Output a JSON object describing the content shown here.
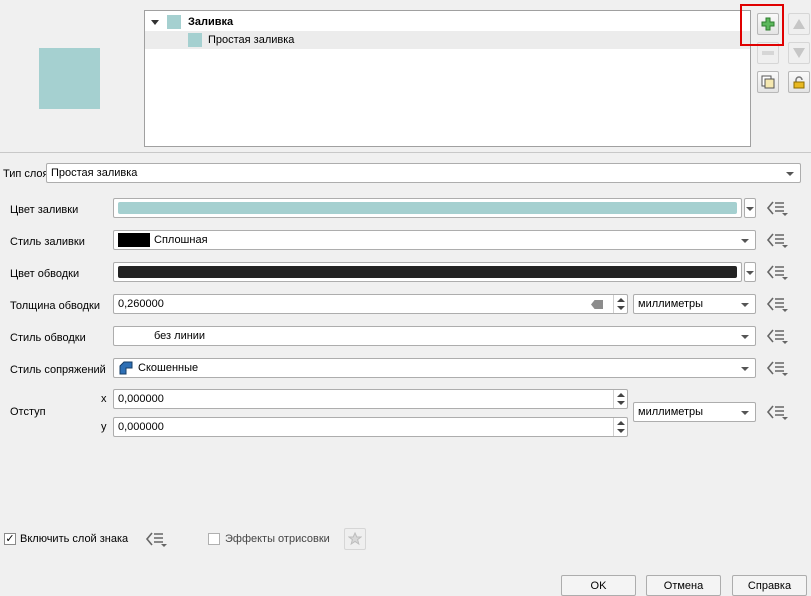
{
  "preview": {
    "color": "#a5d0d0"
  },
  "tree": {
    "items": [
      {
        "label": "Заливка",
        "color": "#a5d0d0"
      },
      {
        "label": "Простая заливка",
        "color": "#a5d0d0"
      }
    ]
  },
  "side_buttons": {
    "add": "plus-icon",
    "remove": "minus-icon",
    "move_up": "arrow-up-icon",
    "move_down": "arrow-down-icon",
    "duplicate": "duplicate-icon",
    "lock": "lock-icon"
  },
  "layer_type": {
    "label": "Тип слоя",
    "value": "Простая заливка"
  },
  "fields": {
    "fill_color": {
      "label": "Цвет заливки",
      "color": "#a5d0d0"
    },
    "fill_style": {
      "label": "Стиль заливки",
      "value": "Сплошная",
      "swatch": "#000000"
    },
    "stroke_color": {
      "label": "Цвет обводки",
      "color": "#232323"
    },
    "stroke_width": {
      "label": "Толщина обводки",
      "value": "0,260000",
      "unit": "миллиметры"
    },
    "stroke_style": {
      "label": "Стиль обводки",
      "value": "без линии"
    },
    "join_style": {
      "label": "Стиль сопряжений",
      "value": "Скошенные"
    },
    "offset": {
      "label": "Отступ",
      "x_label": "x",
      "x_value": "0,000000",
      "y_label": "y",
      "y_value": "0,000000",
      "unit": "миллиметры"
    }
  },
  "footer": {
    "enable_layer": "Включить слой знака",
    "enable_layer_checked": true,
    "draw_effects": "Эффекты отрисовки",
    "draw_effects_checked": false,
    "ok": "OK",
    "cancel": "Отмена",
    "help": "Справка"
  },
  "highlight_color": "#e00000"
}
